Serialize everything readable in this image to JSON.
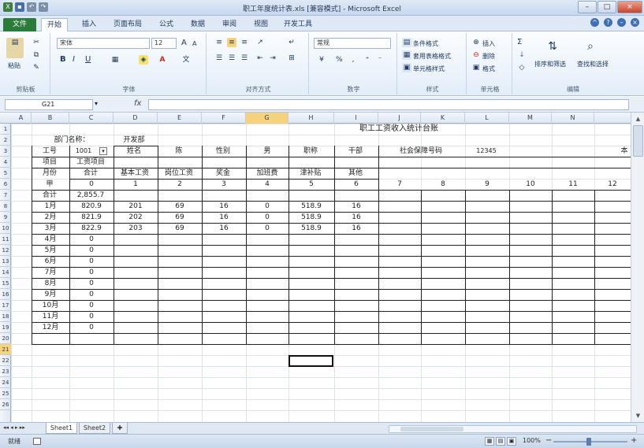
{
  "app": {
    "title": "职工年度统计表.xls [兼容模式] - Microsoft Excel",
    "window_buttons": [
      "–",
      "□",
      "×"
    ]
  },
  "ribbon_tabs": [
    "文件",
    "开始",
    "插入",
    "页面布局",
    "公式",
    "数据",
    "审阅",
    "视图",
    "开发工具"
  ],
  "ribbon": {
    "clipboard": {
      "paste": "粘贴",
      "label": "剪贴板"
    },
    "font": {
      "name": "宋体",
      "size": "12",
      "grow": "A",
      "shrink": "A",
      "bold": "B",
      "italic": "I",
      "underline": "U",
      "label": "字体"
    },
    "alignment": {
      "label": "对齐方式"
    },
    "number": {
      "format": "常规",
      "percent": "%",
      "label": "数字"
    },
    "styles": {
      "conditional": "条件格式",
      "table": "套用表格格式",
      "cell": "单元格样式",
      "label": "样式"
    },
    "cells": {
      "insert": "插入",
      "delete": "删除",
      "format": "格式",
      "label": "单元格"
    },
    "editing": {
      "sort": "排序和筛选",
      "find": "查找和选择",
      "sigma": "Σ",
      "label": "编辑"
    }
  },
  "formula_bar": {
    "name_box": "G21",
    "fx": "fx",
    "value": ""
  },
  "columns": [
    "A",
    "B",
    "C",
    "D",
    "E",
    "F",
    "G",
    "H",
    "I",
    "J",
    "K",
    "L",
    "M",
    "N"
  ],
  "selected_column": "G",
  "rows": [
    "1",
    "2",
    "3",
    "4",
    "5",
    "6",
    "7",
    "8",
    "9",
    "10",
    "11",
    "12",
    "13",
    "14",
    "15",
    "16",
    "17",
    "18",
    "19",
    "20",
    "21",
    "22",
    "23",
    "24",
    "25",
    "26"
  ],
  "selected_row": "21",
  "cells": {
    "title": "职工工资收入统计台账",
    "dept_label": "部门名称：",
    "dept_value": "开发部",
    "emp_no_label": "工号",
    "emp_no_value": "1001",
    "name_label": "姓名",
    "name_value": "陈",
    "gender_label": "性别",
    "gender_value": "男",
    "title_label": "职称",
    "title_value": "干部",
    "ss_label": "社会保障号码",
    "ss_value": "12345",
    "ss_extra": "本",
    "item_label": "项目",
    "salary_item": "工资项目",
    "month_label": "月份",
    "total": "合计",
    "headers": [
      "基本工资",
      "岗位工资",
      "奖金",
      "加班费",
      "津补贴",
      "其他"
    ],
    "index_label": "甲",
    "index_numbers": [
      "0",
      "1",
      "2",
      "3",
      "4",
      "5",
      "6",
      "7",
      "8",
      "9",
      "10",
      "11",
      "12"
    ],
    "grand_total_label": "合计",
    "grand_total_value": "2,855.7",
    "months": [
      {
        "label": "1月",
        "total": "820.9",
        "vals": [
          "201",
          "69",
          "16",
          "0",
          "518.9",
          "16"
        ]
      },
      {
        "label": "2月",
        "total": "821.9",
        "vals": [
          "202",
          "69",
          "16",
          "0",
          "518.9",
          "16"
        ]
      },
      {
        "label": "3月",
        "total": "822.9",
        "vals": [
          "203",
          "69",
          "16",
          "0",
          "518.9",
          "16"
        ]
      },
      {
        "label": "4月",
        "total": "0"
      },
      {
        "label": "5月",
        "total": "0"
      },
      {
        "label": "6月",
        "total": "0"
      },
      {
        "label": "7月",
        "total": "0"
      },
      {
        "label": "8月",
        "total": "0"
      },
      {
        "label": "9月",
        "total": "0"
      },
      {
        "label": "10月",
        "total": "0"
      },
      {
        "label": "11月",
        "total": "0"
      },
      {
        "label": "12月",
        "total": "0"
      }
    ]
  },
  "sheet_tabs": [
    "Sheet1",
    "Sheet2"
  ],
  "active_sheet": "Sheet1",
  "status": {
    "ready": "就绪",
    "zoom": "100%"
  }
}
